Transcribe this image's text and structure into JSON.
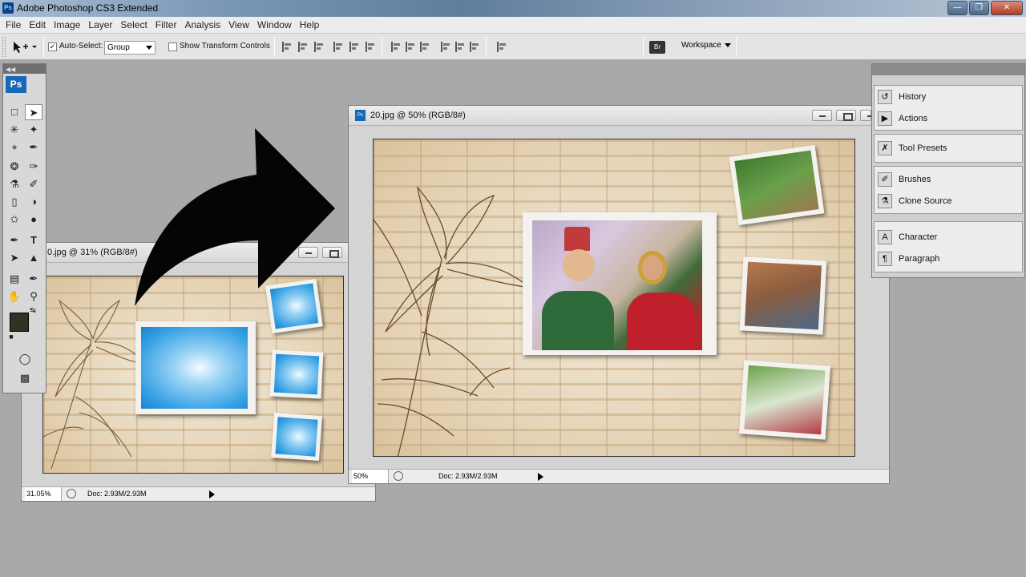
{
  "app": {
    "title": "Adobe Photoshop CS3 Extended",
    "icon": "ps-app-icon"
  },
  "window_controls": [
    "minimize-icon",
    "restore-icon",
    "close-icon"
  ],
  "menu": [
    "File",
    "Edit",
    "Image",
    "Layer",
    "Select",
    "Filter",
    "Analysis",
    "View",
    "Window",
    "Help"
  ],
  "options_bar": {
    "auto_select_label": "Auto-Select:",
    "auto_select_checked": true,
    "auto_select_value": "Group",
    "show_transform_label": "Show Transform Controls",
    "show_transform_checked": false,
    "workspace_label": "Workspace"
  },
  "tools_panel": {
    "logo": "Ps"
  },
  "doc_small": {
    "title": "0.jpg @ 31% (RGB/8#)",
    "zoom": "31.05%",
    "doc_info": "Doc: 2.93M/2.93M"
  },
  "doc_large": {
    "title": "20.jpg @ 50% (RGB/8#)",
    "zoom": "50%",
    "doc_info": "Doc: 2.93M/2.93M"
  },
  "panels": [
    {
      "label": "History",
      "icon": "history-icon"
    },
    {
      "label": "Actions",
      "icon": "actions-icon"
    },
    {
      "label": "Tool Presets",
      "icon": "tool-presets-icon"
    },
    {
      "label": "Brushes",
      "icon": "brushes-icon"
    },
    {
      "label": "Clone Source",
      "icon": "clone-source-icon"
    },
    {
      "label": "Character",
      "icon": "character-icon"
    },
    {
      "label": "Paragraph",
      "icon": "paragraph-icon"
    }
  ],
  "colors": {
    "foreground": "#303324",
    "background": "#ffffff",
    "ps_blue": "#1768b8"
  }
}
